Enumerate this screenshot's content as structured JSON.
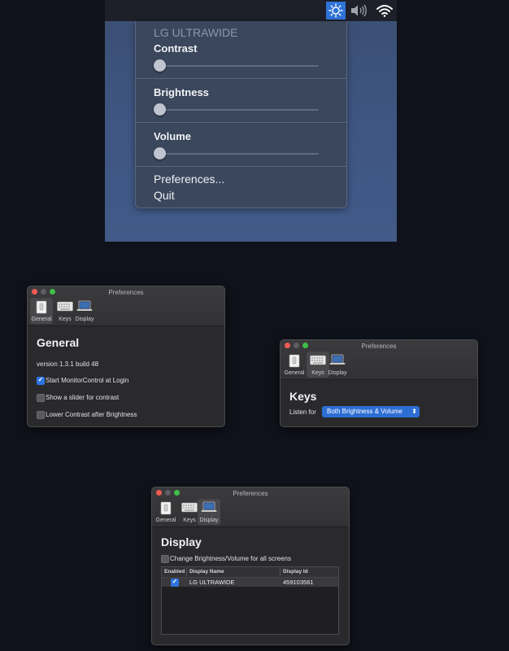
{
  "menu": {
    "display_name": "LG ULTRAWIDE",
    "sliders": [
      {
        "label": "Contrast",
        "value": 0
      },
      {
        "label": "Brightness",
        "value": 0
      },
      {
        "label": "Volume",
        "value": 0
      }
    ],
    "preferences_label": "Preferences...",
    "quit_label": "Quit",
    "menubar_icons": [
      "brightness-icon",
      "volume-icon",
      "wifi-icon"
    ]
  },
  "windows": {
    "title": "Preferences",
    "tabs": [
      "General",
      "Keys",
      "Display"
    ]
  },
  "general": {
    "heading": "General",
    "version": "version 1.3.1 build 48",
    "options": [
      {
        "label": "Start MonitorControl at Login",
        "checked": true
      },
      {
        "label": "Show a slider for contrast",
        "checked": false
      },
      {
        "label": "Lower Contrast after Brightness",
        "checked": false
      }
    ]
  },
  "keys": {
    "heading": "Keys",
    "listen_label": "Listen for",
    "listen_value": "Both Brightness & Volume"
  },
  "display": {
    "heading": "Display",
    "all_screens_label": "Change Brightness/Volume for all screens",
    "all_screens_checked": false,
    "columns": [
      "Enabled",
      "Display Name",
      "Display Id"
    ],
    "rows": [
      {
        "enabled": true,
        "name": "LG ULTRAWIDE",
        "id": "459103561"
      }
    ]
  },
  "colors": {
    "accent": "#2d74e0",
    "desktop": "#0f121a"
  }
}
